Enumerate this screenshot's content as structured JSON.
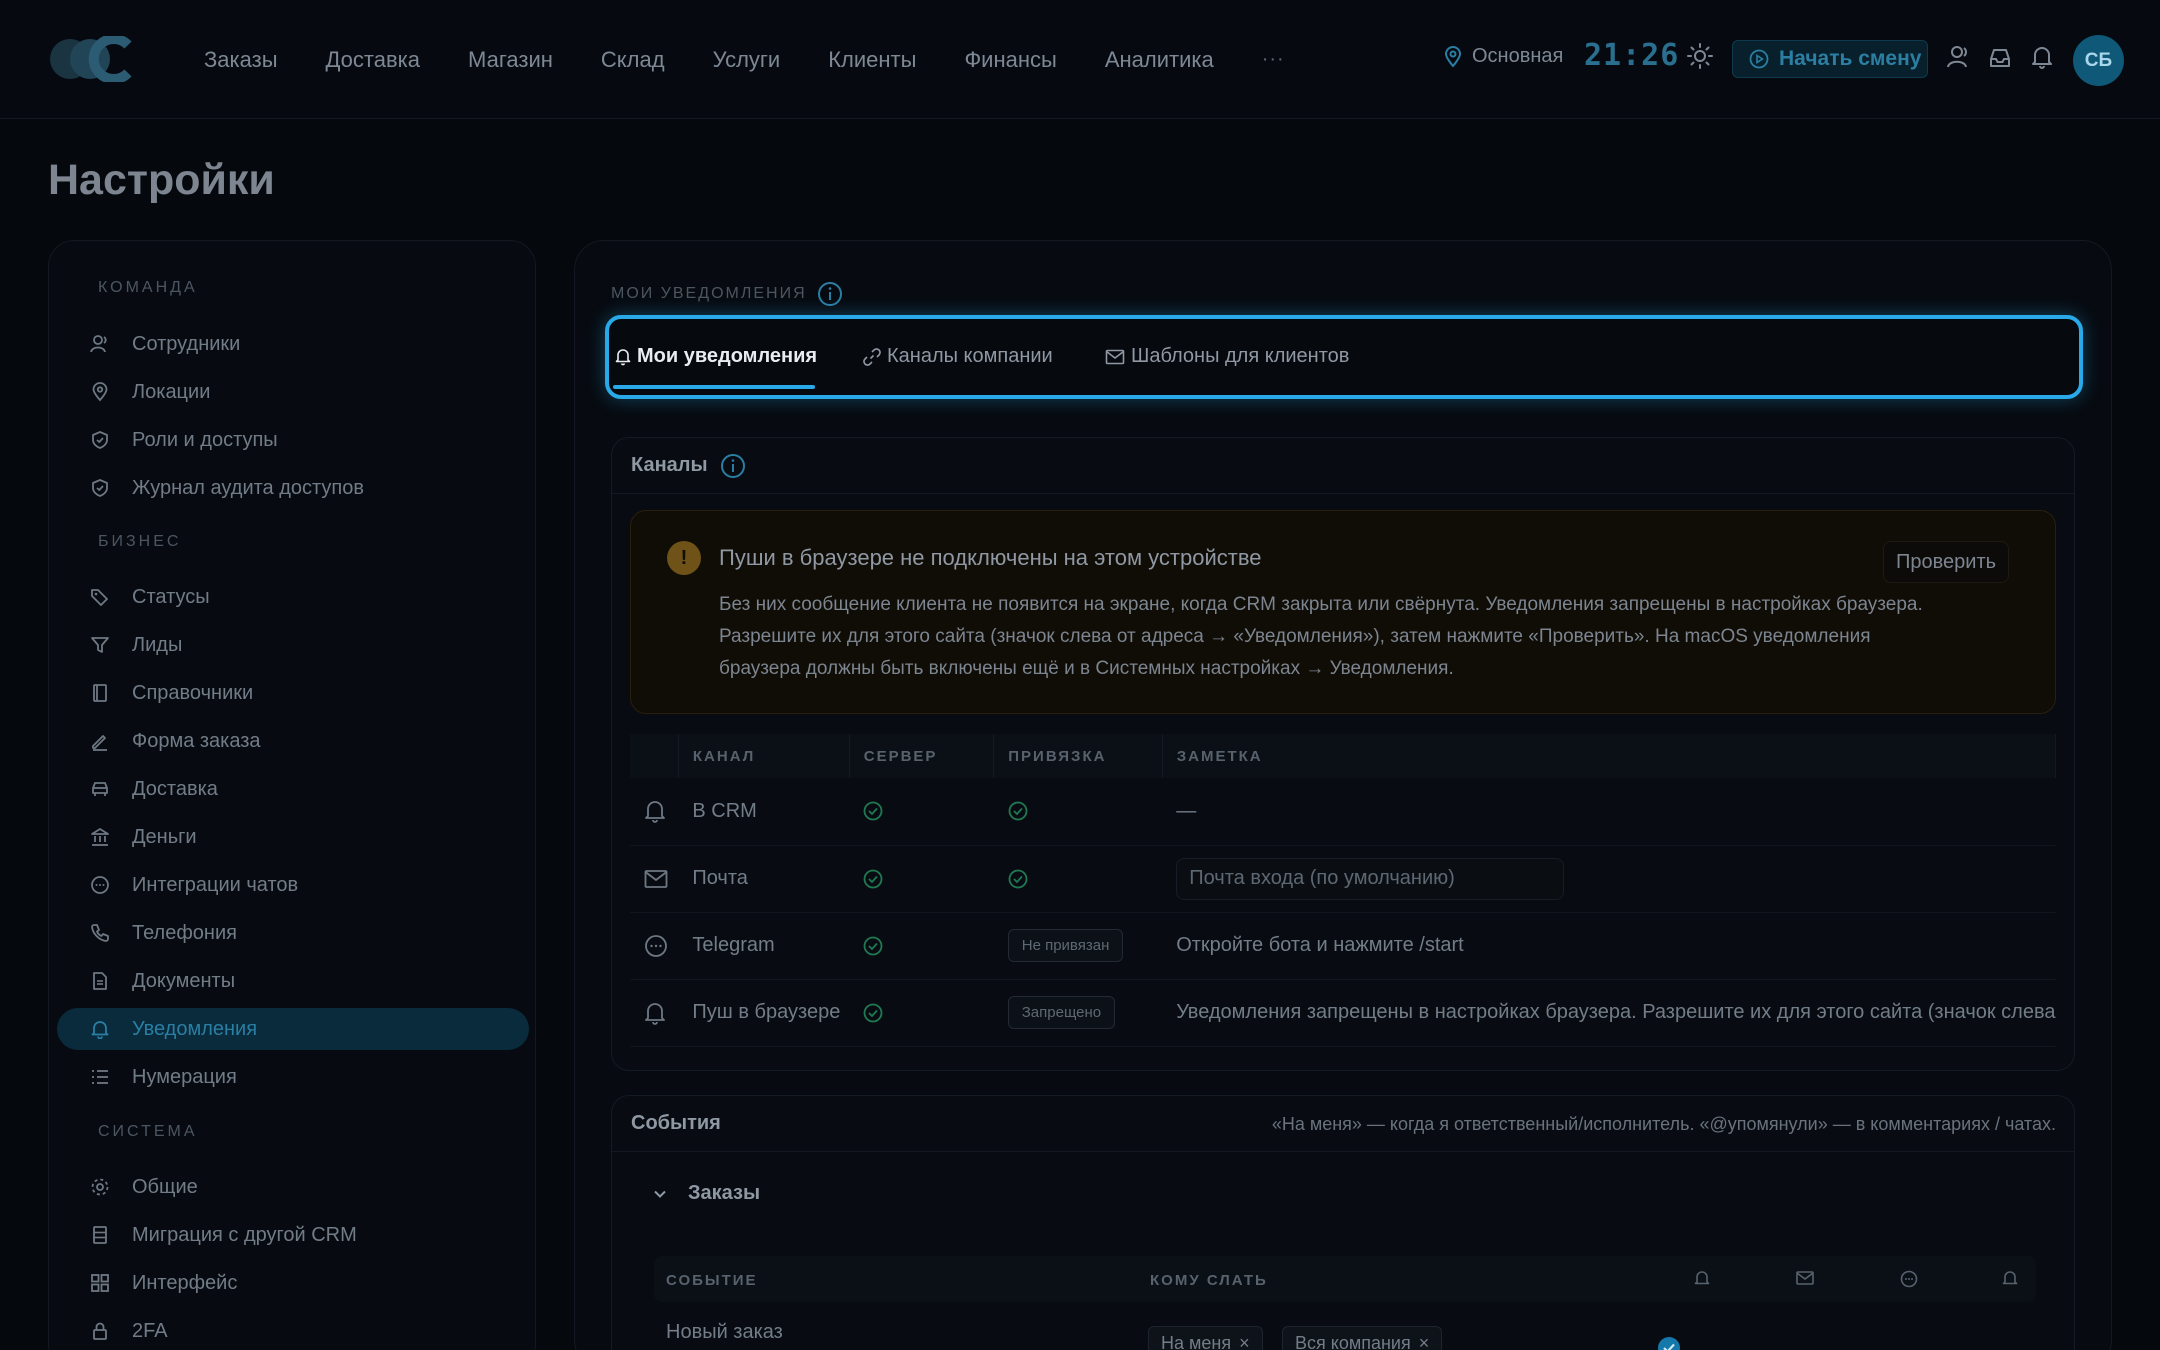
{
  "header": {
    "nav": [
      "Заказы",
      "Доставка",
      "Магазин",
      "Склад",
      "Услуги",
      "Клиенты",
      "Финансы",
      "Аналитика"
    ],
    "more": "···",
    "location": "Основная",
    "clock": "21:26",
    "start_shift": "Начать смену",
    "avatar": "СБ"
  },
  "page": {
    "title": "Настройки"
  },
  "sidebar": {
    "sections": [
      "КОМАНДА",
      "БИЗНЕС",
      "СИСТЕМА"
    ],
    "items": [
      {
        "label": "Сотрудники",
        "icon": "users-icon"
      },
      {
        "label": "Локации",
        "icon": "map-pin-icon"
      },
      {
        "label": "Роли и доступы",
        "icon": "shield-icon"
      },
      {
        "label": "Журнал аудита доступов",
        "icon": "shield-check-icon"
      },
      {
        "label": "Статусы",
        "icon": "tag-icon"
      },
      {
        "label": "Лиды",
        "icon": "funnel-icon"
      },
      {
        "label": "Справочники",
        "icon": "book-icon"
      },
      {
        "label": "Форма заказа",
        "icon": "pen-icon"
      },
      {
        "label": "Доставка",
        "icon": "car-icon"
      },
      {
        "label": "Деньги",
        "icon": "bank-icon"
      },
      {
        "label": "Интеграции чатов",
        "icon": "chat-icon"
      },
      {
        "label": "Телефония",
        "icon": "phone-icon"
      },
      {
        "label": "Документы",
        "icon": "document-icon"
      },
      {
        "label": "Уведомления",
        "icon": "bell-icon"
      },
      {
        "label": "Нумерация",
        "icon": "list-icon"
      },
      {
        "label": "Общие",
        "icon": "gear-icon"
      },
      {
        "label": "Миграция с другой CRM",
        "icon": "database-icon"
      },
      {
        "label": "Интерфейс",
        "icon": "grid-icon"
      },
      {
        "label": "2FA",
        "icon": "lock-icon"
      }
    ]
  },
  "main": {
    "section_label": "МОИ УВЕДОМЛЕНИЯ",
    "tabs": [
      "Мои уведомления",
      "Каналы компании",
      "Шаблоны для клиентов"
    ],
    "channels": {
      "title": "Каналы",
      "warning_title": "Пуши в браузере не подключены на этом устройстве",
      "warning_text": "Без них сообщение клиента не появится на экране, когда CRM закрыта или свёрнута. Уведомления запрещены в настройках браузера. Разрешите их для этого сайта (значок слева от адреса → «Уведомления»), затем нажмите «Проверить». На macOS уведомления браузера должны быть включены ещё и в Системных настройках → Уведомления.",
      "warning_icon": "!",
      "check_button": "Проверить",
      "columns": [
        "КАНАЛ",
        "СЕРВЕР",
        "ПРИВЯЗКА",
        "ЗАМЕТКА"
      ],
      "rows": [
        {
          "name": "В CRM",
          "binding": "ok",
          "note": "—"
        },
        {
          "name": "Почта",
          "binding": "ok",
          "note_placeholder": "Почта входа (по умолчанию)"
        },
        {
          "name": "Telegram",
          "binding_badge": "Не привязан",
          "note": "Откройте бота и нажмите /start"
        },
        {
          "name": "Пуш в браузере",
          "binding_badge": "Запрещено",
          "note": "Уведомления запрещены в настройках браузера. Разрешите их для этого сайта (значок слева"
        }
      ]
    },
    "events": {
      "title": "События",
      "hint": "«На меня» — когда я ответственный/исполнитель. «@упомянули» — в комментариях / чатах.",
      "group": "Заказы",
      "columns": [
        "СОБЫТИЕ",
        "КОМУ СЛАТЬ"
      ],
      "first_row": "Новый заказ",
      "chips": [
        "На меня",
        "Вся компания"
      ]
    }
  },
  "colors": {
    "accent": "#29a9e7",
    "success": "#1f7a52",
    "warning": "#6e5217"
  }
}
